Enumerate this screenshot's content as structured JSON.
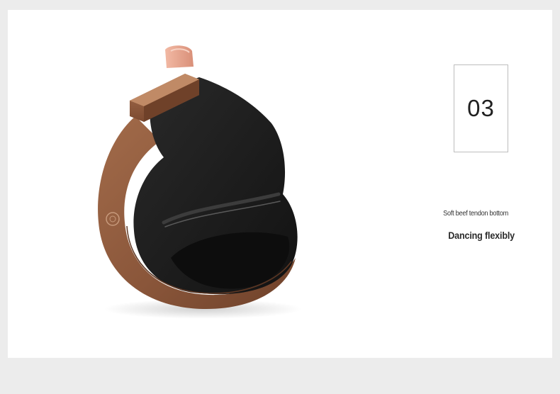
{
  "feature": {
    "number": "03",
    "subtitle": "Soft beef tendon bottom",
    "title": "Dancing flexibly"
  },
  "colors": {
    "page_background": "#ececec",
    "card_background": "#ffffff",
    "sole_brown": "#8b5a3e",
    "canvas_black": "#1c1c1c",
    "box_border": "#bdbdbd"
  },
  "image": {
    "subject": "black canvas shoe folded showing flexible brown sole"
  }
}
